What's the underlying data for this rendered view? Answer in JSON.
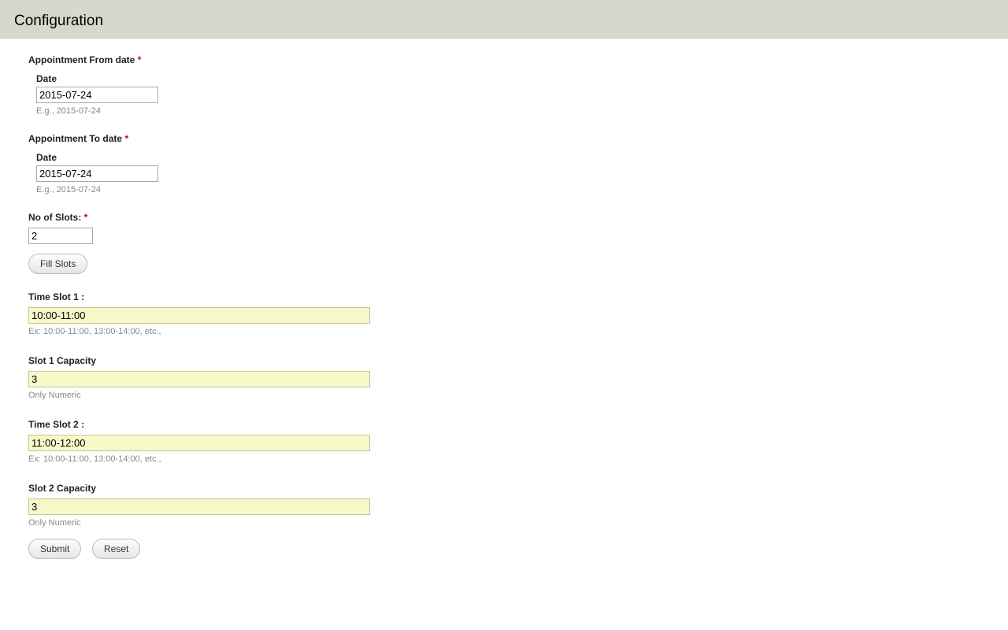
{
  "header": {
    "title": "Configuration"
  },
  "form": {
    "appt_from": {
      "label": "Appointment From date",
      "required": "*",
      "date_label": "Date",
      "date_value": "2015-07-24",
      "helper": "E.g., 2015-07-24"
    },
    "appt_to": {
      "label": "Appointment To date",
      "required": "*",
      "date_label": "Date",
      "date_value": "2015-07-24",
      "helper": "E.g., 2015-07-24"
    },
    "no_slots": {
      "label": "No of Slots:",
      "required": "*",
      "value": "2"
    },
    "fill_slots_label": "Fill Slots",
    "slots": [
      {
        "time_label": "Time Slot 1 :",
        "time_value": "10:00-11:00",
        "time_helper": "Ex: 10:00-11:00, 13:00-14:00, etc.,",
        "cap_label": "Slot 1 Capacity",
        "cap_value": "3",
        "cap_helper": "Only Numeric"
      },
      {
        "time_label": "Time Slot 2 :",
        "time_value": "11:00-12:00",
        "time_helper": "Ex: 10:00-11:00, 13:00-14:00, etc.,",
        "cap_label": "Slot 2 Capacity",
        "cap_value": "3",
        "cap_helper": "Only Numeric"
      }
    ],
    "submit_label": "Submit",
    "reset_label": "Reset"
  }
}
